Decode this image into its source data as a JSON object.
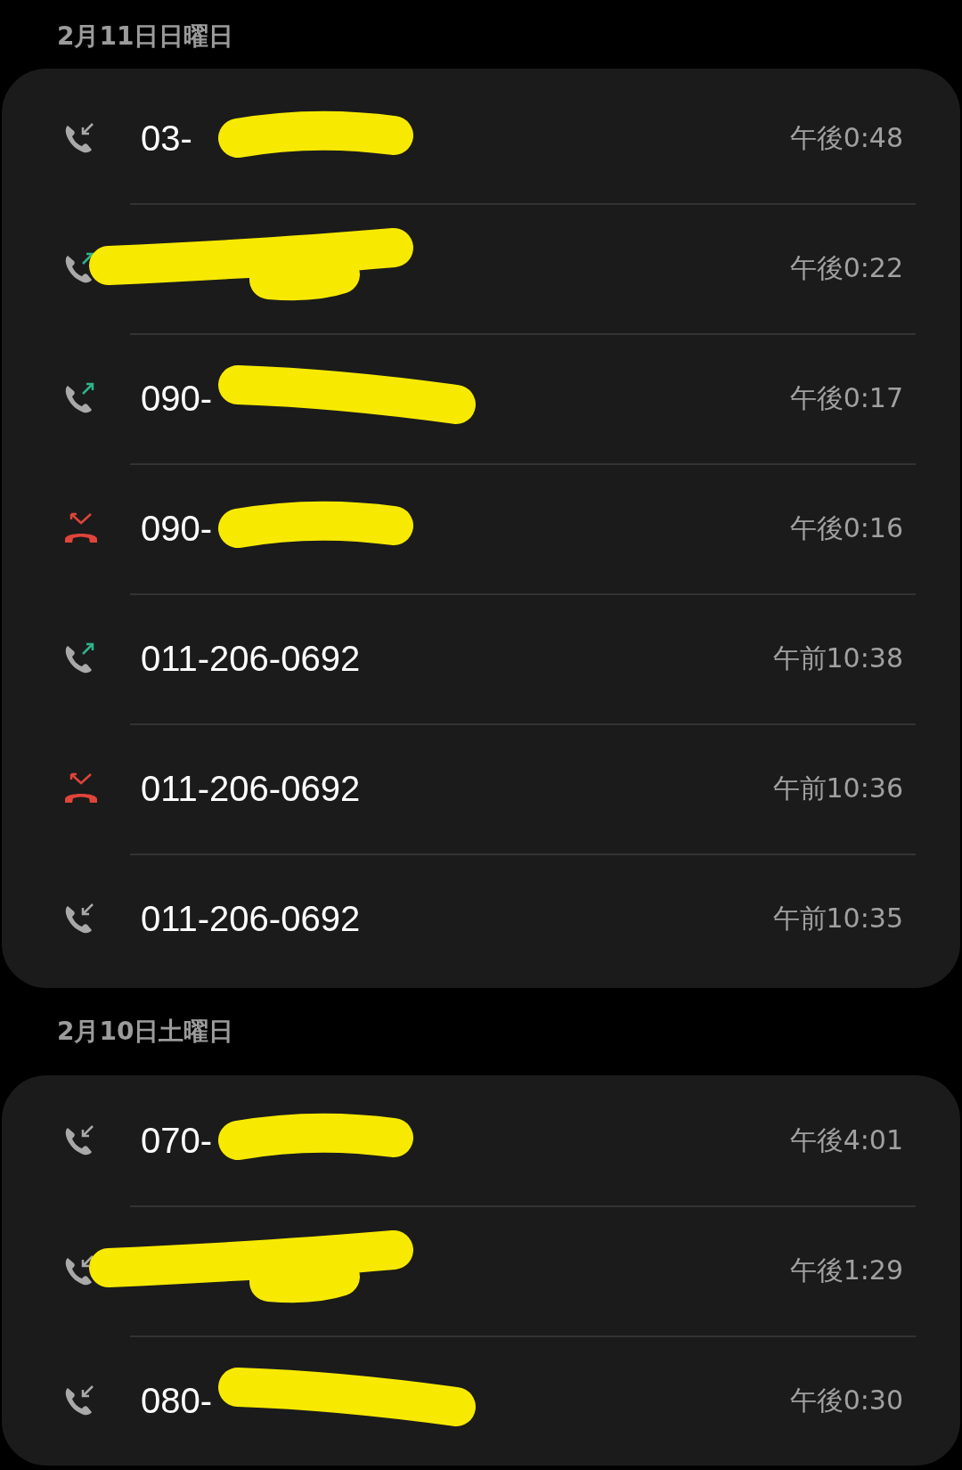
{
  "sections": [
    {
      "date": "2月11日日曜日",
      "calls": [
        {
          "kind": "incoming",
          "number": "03-",
          "time": "午後0:48",
          "redacted": true
        },
        {
          "kind": "outgoing",
          "time": "午後0:22",
          "redacted": true
        },
        {
          "kind": "outgoing",
          "number": "090-",
          "time": "午後0:17",
          "redacted": true
        },
        {
          "kind": "missed",
          "number": "090-",
          "time": "午後0:16",
          "redacted": true
        },
        {
          "kind": "outgoing",
          "number": "011-206-0692",
          "time": "午前10:38",
          "redacted": false
        },
        {
          "kind": "missed",
          "number": "011-206-0692",
          "time": "午前10:36",
          "redacted": false
        },
        {
          "kind": "incoming",
          "number": "011-206-0692",
          "time": "午前10:35",
          "redacted": false
        }
      ]
    },
    {
      "date": "2月10日土曜日",
      "calls": [
        {
          "kind": "incoming",
          "number": "070-",
          "time": "午後4:01",
          "redacted": true
        },
        {
          "kind": "incoming",
          "time": "午後1:29",
          "redacted": true
        },
        {
          "kind": "incoming",
          "number": "080-",
          "time": "午後0:30",
          "redacted": true
        }
      ]
    }
  ]
}
